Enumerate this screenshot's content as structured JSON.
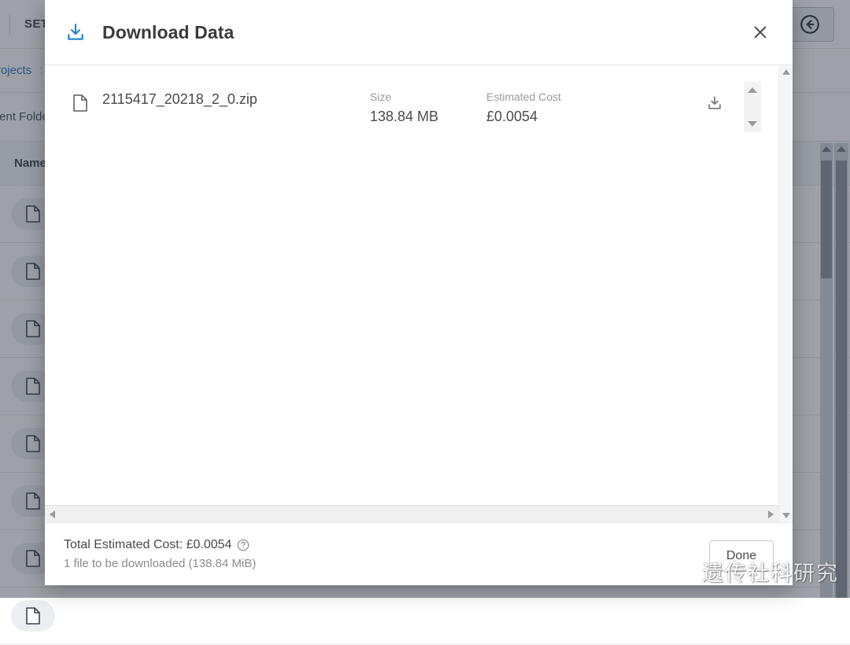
{
  "background_app": {
    "topbar": {
      "settings_label": "SETTINGS",
      "back_icon": "arrow-left-circle-icon"
    },
    "breadcrumb": {
      "projects_link": "Projects",
      "separator": ":"
    },
    "current_folder_label": "Current Folder",
    "table": {
      "columns": [
        "Name"
      ],
      "row_icon": "file-icon",
      "row_count": 8
    },
    "scrollbars": {
      "vertical": "visible",
      "horizontal": "hidden"
    }
  },
  "modal": {
    "title": "Download Data",
    "title_icon": "download-icon",
    "close_icon": "close-icon",
    "columns": {
      "size_label": "Size",
      "cost_label": "Estimated Cost"
    },
    "files": [
      {
        "icon": "file-icon",
        "name": "2115417_20218_2_0.zip",
        "size": "138.84 MB",
        "estimated_cost": "£0.0054",
        "download_icon": "download-icon",
        "spinner": {
          "up_icon": "caret-up-icon",
          "down_icon": "caret-down-icon"
        }
      }
    ],
    "scrollbar": {
      "v_up_icon": "caret-up-icon",
      "v_down_icon": "caret-down-icon",
      "h_left_icon": "caret-left-icon",
      "h_right_icon": "caret-right-icon"
    },
    "footer": {
      "total_label": "Total Estimated Cost: £0.0054",
      "help_icon": "question-circle-icon",
      "subtext": "1 file to be downloaded (138.84 MiB)",
      "done_label": "Done"
    }
  },
  "watermark": {
    "logo_icon": "wechat-icon",
    "text": "遗传社科研究"
  },
  "colors": {
    "accent": "#1d87c8",
    "title_text": "#3b3b3b",
    "muted_text": "#9a9a9a",
    "link": "#2a6ebb",
    "overlay": "#2c3442"
  }
}
